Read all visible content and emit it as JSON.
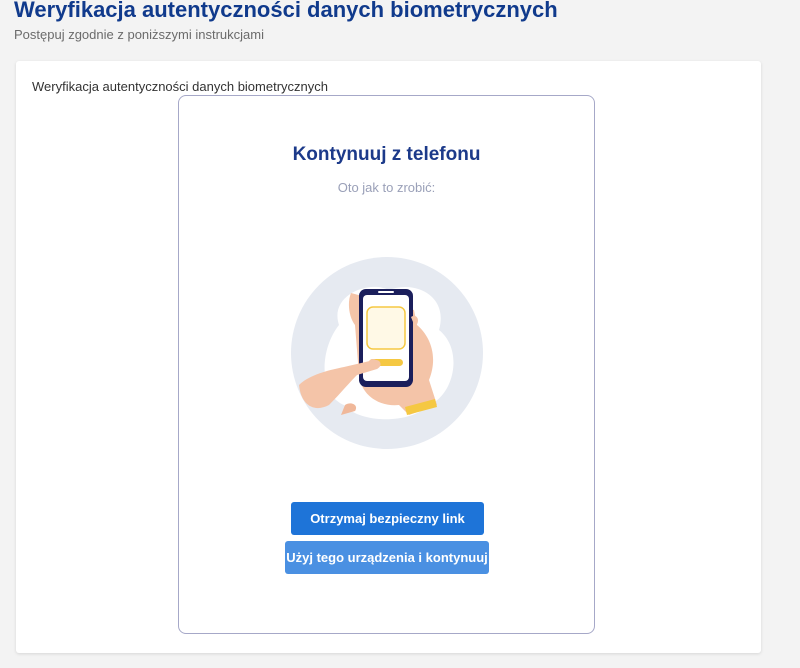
{
  "header": {
    "title": "Weryfikacja autentyczności danych biometrycznych",
    "subtitle": "Postępuj zgodnie z poniższymi instrukcjami"
  },
  "card": {
    "section_label": "Weryfikacja autentyczności danych biometrycznych",
    "heading": "Kontynuuj z telefonu",
    "subheading": "Oto jak to zrobić:",
    "illustration_icon": "hand-holding-phone-illustration",
    "buttons": {
      "secure_link": "Otrzymaj bezpieczny link",
      "use_this_device": "Użyj tego urządzenia i kontynuuj"
    }
  },
  "colors": {
    "title": "#103a8c",
    "heading": "#1c3a8a",
    "primary_button": "#1e74d8",
    "secondary_button": "#4a90e2",
    "frame_border": "#a6a8c8",
    "accent_yellow": "#f5c842"
  }
}
